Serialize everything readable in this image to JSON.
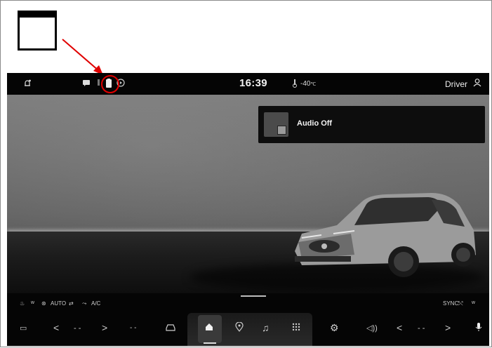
{
  "status_bar": {
    "clock": "16:39",
    "temperature": "-40",
    "temperature_unit": "℃",
    "driver_label": "Driver"
  },
  "audio_panel": {
    "label": "Audio Off"
  },
  "climate": {
    "auto_label": "AUTO",
    "ac_label": "A/C",
    "sync_label": "SYNC"
  },
  "nav": {
    "left_temp": "- -",
    "right_temp": "- -",
    "fan_level": "- -"
  },
  "icons": {
    "notification": "bell-icon",
    "message": "message-icon",
    "phone": "phone-icon",
    "highlighted": "phone-battery-icon",
    "media": "media-icon",
    "driver": "person-icon",
    "home": "home-icon",
    "navigation": "map-pin-icon",
    "music": "music-note-icon",
    "apps": "apps-grid-icon",
    "settings": "gear-icon",
    "volume": "volume-icon",
    "microphone": "microphone-icon",
    "car": "car-icon"
  },
  "colors": {
    "callout": "#e00000",
    "background": "#050505"
  }
}
